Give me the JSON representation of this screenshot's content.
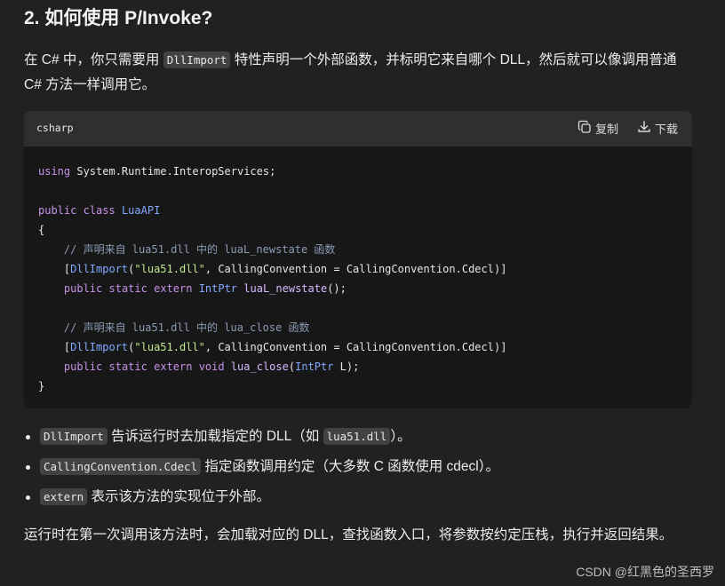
{
  "heading": "2. 如何使用 P/Invoke?",
  "intro": {
    "before": "在 C# 中，你只需要用 ",
    "code": "DllImport",
    "after": " 特性声明一个外部函数，并标明它来自哪个 DLL，然后就可以像调用普通 C# 方法一样调用它。"
  },
  "codeblock": {
    "language": "csharp",
    "copy_label": "复制",
    "download_label": "下载",
    "lines": [
      "using System.Runtime.InteropServices;",
      "",
      "public class LuaAPI",
      "{",
      "    // 声明来自 lua51.dll 中的 luaL_newstate 函数",
      "    [DllImport(\"lua51.dll\", CallingConvention = CallingConvention.Cdecl)]",
      "    public static extern IntPtr luaL_newstate();",
      "",
      "    // 声明来自 lua51.dll 中的 lua_close 函数",
      "    [DllImport(\"lua51.dll\", CallingConvention = CallingConvention.Cdecl)]",
      "    public static extern void lua_close(IntPtr L);",
      "}"
    ]
  },
  "bullets": [
    {
      "code": "DllImport",
      "text_before": " 告诉运行时去加载指定的 DLL（如 ",
      "code2": "lua51.dll",
      "text_after": "）。"
    },
    {
      "code": "CallingConvention.Cdecl",
      "text_before": " 指定函数调用约定（大多数 C 函数使用 cdecl）。"
    },
    {
      "code": "extern",
      "text_before": " 表示该方法的实现位于外部。"
    }
  ],
  "outro": "运行时在第一次调用该方法时，会加载对应的 DLL，查找函数入口，将参数按约定压栈，执行并返回结果。",
  "watermark": "CSDN @红黑色的圣西罗",
  "colors": {
    "background": "#212121",
    "code_background": "#171717",
    "code_header": "#2f2f2f",
    "inline_code_bg": "#424242"
  }
}
